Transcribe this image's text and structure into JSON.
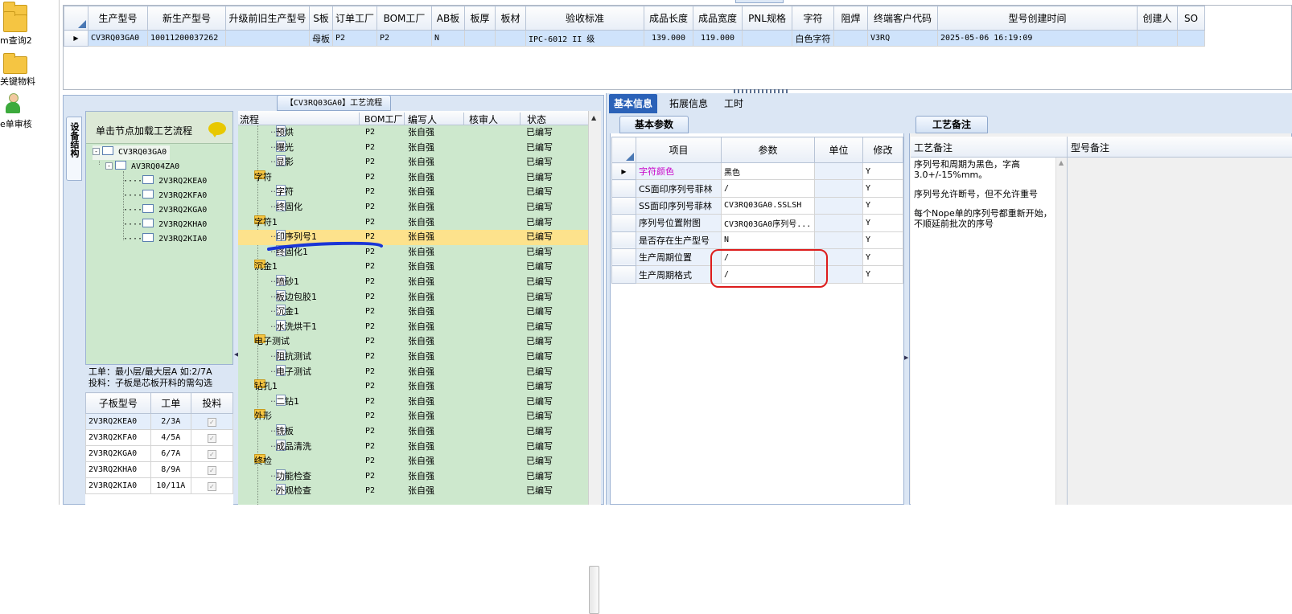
{
  "nav": {
    "items": [
      {
        "label": "",
        "icon": "folder-icon"
      },
      {
        "label": "m查询2",
        "icon": "folder-icon"
      },
      {
        "label": "关键物料",
        "icon": "folder-icon"
      },
      {
        "label": "e单审核",
        "icon": "person-icon"
      }
    ]
  },
  "top_grid": {
    "columns": [
      "生产型号",
      "新生产型号",
      "升级前旧生产型号",
      "S板",
      "订单工厂",
      "BOM工厂",
      "AB板",
      "板厚",
      "板材",
      "验收标准",
      "成品长度",
      "成品宽度",
      "PNL规格",
      "字符",
      "阻焊",
      "终端客户代码",
      "型号创建时间",
      "创建人",
      "SO"
    ],
    "rows": [
      [
        "CV3RQ03GA0",
        "10011200037262",
        "",
        "母板",
        "P2",
        "P2",
        "N",
        "",
        "",
        "IPC-6012 II 级",
        "139.000",
        "119.000",
        "",
        "白色字符",
        "",
        "V3RQ",
        "2025-05-06 16:19:09",
        "",
        ""
      ]
    ]
  },
  "process_title": "【CV3RQ03GA0】工艺流程",
  "left_tree": {
    "vertical_tab": "设备结构",
    "hint": "单击节点加载工艺流程",
    "root": "CV3RQ03GA0",
    "child": "AV3RQ04ZA0",
    "leaves": [
      "2V3RQ2KEA0",
      "2V3RQ2KFA0",
      "2V3RQ2KGA0",
      "2V3RQ2KHA0",
      "2V3RQ2KIA0"
    ]
  },
  "layer_info": {
    "line1": "工单：最小层/最大层A 如:2/7A",
    "line2": "投料：子板是芯板开料的需勾选"
  },
  "sub_table": {
    "columns": [
      "子板型号",
      "工单",
      "投料"
    ],
    "rows": [
      [
        "2V3RQ2KEA0",
        "2/3A"
      ],
      [
        "2V3RQ2KFA0",
        "4/5A"
      ],
      [
        "2V3RQ2KGA0",
        "6/7A"
      ],
      [
        "2V3RQ2KHA0",
        "8/9A"
      ],
      [
        "2V3RQ2KIA0",
        "10/11A"
      ]
    ]
  },
  "flow": {
    "columns": [
      "流程",
      "BOM工厂",
      "编写人",
      "核审人",
      "状态"
    ],
    "rows": [
      {
        "name": "预烘",
        "kind": "leaf",
        "factory": "P2",
        "writer": "张自强",
        "status": "已编写"
      },
      {
        "name": "曝光",
        "kind": "leaf",
        "factory": "P2",
        "writer": "张自强",
        "status": "已编写"
      },
      {
        "name": "显影",
        "kind": "leaf",
        "factory": "P2",
        "writer": "张自强",
        "status": "已编写"
      },
      {
        "name": "字符",
        "kind": "group",
        "factory": "P2",
        "writer": "张自强",
        "status": "已编写"
      },
      {
        "name": "字符",
        "kind": "leaf",
        "factory": "P2",
        "writer": "张自强",
        "status": "已编写"
      },
      {
        "name": "终固化",
        "kind": "leaf",
        "factory": "P2",
        "writer": "张自强",
        "status": "已编写"
      },
      {
        "name": "字符1",
        "kind": "group",
        "factory": "P2",
        "writer": "张自强",
        "status": "已编写"
      },
      {
        "name": "印序列号1",
        "kind": "leaf",
        "factory": "P2",
        "writer": "张自强",
        "status": "已编写",
        "selected": true
      },
      {
        "name": "终固化1",
        "kind": "leaf",
        "factory": "P2",
        "writer": "张自强",
        "status": "已编写"
      },
      {
        "name": "沉金1",
        "kind": "group",
        "factory": "P2",
        "writer": "张自强",
        "status": "已编写"
      },
      {
        "name": "喷砂1",
        "kind": "leaf",
        "factory": "P2",
        "writer": "张自强",
        "status": "已编写"
      },
      {
        "name": "板边包胶1",
        "kind": "leaf",
        "factory": "P2",
        "writer": "张自强",
        "status": "已编写"
      },
      {
        "name": "沉金1",
        "kind": "leaf",
        "factory": "P2",
        "writer": "张自强",
        "status": "已编写"
      },
      {
        "name": "水洗烘干1",
        "kind": "leaf",
        "factory": "P2",
        "writer": "张自强",
        "status": "已编写"
      },
      {
        "name": "电子测试",
        "kind": "group",
        "factory": "P2",
        "writer": "张自强",
        "status": "已编写"
      },
      {
        "name": "阻抗测试",
        "kind": "leaf",
        "factory": "P2",
        "writer": "张自强",
        "status": "已编写"
      },
      {
        "name": "电子测试",
        "kind": "leaf",
        "factory": "P2",
        "writer": "张自强",
        "status": "已编写"
      },
      {
        "name": "钻孔1",
        "kind": "group",
        "factory": "P2",
        "writer": "张自强",
        "status": "已编写"
      },
      {
        "name": "二钻1",
        "kind": "leaf",
        "factory": "P2",
        "writer": "张自强",
        "status": "已编写"
      },
      {
        "name": "外形",
        "kind": "group",
        "factory": "P2",
        "writer": "张自强",
        "status": "已编写"
      },
      {
        "name": "铣板",
        "kind": "leaf",
        "factory": "P2",
        "writer": "张自强",
        "status": "已编写"
      },
      {
        "name": "成品清洗",
        "kind": "leaf",
        "factory": "P2",
        "writer": "张自强",
        "status": "已编写"
      },
      {
        "name": "终检",
        "kind": "group",
        "factory": "P2",
        "writer": "张自强",
        "status": "已编写"
      },
      {
        "name": "功能检查",
        "kind": "leaf",
        "factory": "P2",
        "writer": "张自强",
        "status": "已编写"
      },
      {
        "name": "外观检查",
        "kind": "leaf",
        "factory": "P2",
        "writer": "张自强",
        "status": "已编写"
      }
    ]
  },
  "tabs": [
    "基本信息",
    "拓展信息",
    "工时"
  ],
  "basic_params": {
    "title": "基本参数",
    "columns": [
      "项目",
      "参数",
      "单位",
      "修改"
    ],
    "rows": [
      [
        "字符颜色",
        "黑色",
        "",
        "Y"
      ],
      [
        "CS面印序列号菲林",
        "/",
        "",
        "Y"
      ],
      [
        "SS面印序列号菲林",
        "CV3RQ03GA0.SSLSH",
        "",
        "Y"
      ],
      [
        "序列号位置附图",
        "CV3RQ03GA0序列号...",
        "",
        "Y"
      ],
      [
        "是否存在生产型号",
        "N",
        "",
        "Y"
      ],
      [
        "生产周期位置",
        "/",
        "",
        "Y"
      ],
      [
        "生产周期格式",
        "/",
        "",
        "Y"
      ]
    ],
    "highlight_color": "#c800c8"
  },
  "notes": {
    "title": "工艺备注",
    "col1": "工艺备注",
    "col2": "型号备注",
    "lines": [
      "序列号和周期为黑色，字高",
      "3.0+/-15%mm。",
      "",
      "序列号允许断号，但不允许重号",
      "",
      "每个Nope单的序列号都重新开始，",
      "不顺延前批次的序号"
    ]
  },
  "colors": {
    "accent": "#2b62b8",
    "tree_bg": "#cde8cd",
    "selected_row": "#fde28c",
    "grid_sel": "#cfe3fb"
  }
}
